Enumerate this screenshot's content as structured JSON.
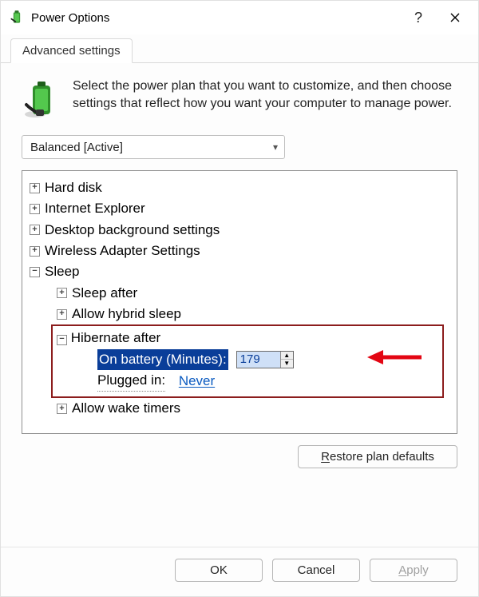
{
  "window": {
    "title": "Power Options"
  },
  "tabs": {
    "advanced": "Advanced settings"
  },
  "intro": {
    "text": "Select the power plan that you want to customize, and then choose settings that reflect how you want your computer to manage power."
  },
  "plan": {
    "selected": "Balanced [Active]"
  },
  "tree": {
    "hard_disk": "Hard disk",
    "ie": "Internet Explorer",
    "desktop_bg": "Desktop background settings",
    "wireless": "Wireless Adapter Settings",
    "sleep": "Sleep",
    "sleep_after": "Sleep after",
    "allow_hybrid": "Allow hybrid sleep",
    "hibernate_after": "Hibernate after",
    "on_battery_label": "On battery (Minutes):",
    "on_battery_value": "179",
    "plugged_in_label": "Plugged in:",
    "plugged_in_value": "Never",
    "allow_wake": "Allow wake timers"
  },
  "buttons": {
    "restore_prefix": "R",
    "restore_rest": "estore plan defaults",
    "ok": "OK",
    "cancel": "Cancel",
    "apply_prefix": "A",
    "apply_rest": "pply"
  }
}
